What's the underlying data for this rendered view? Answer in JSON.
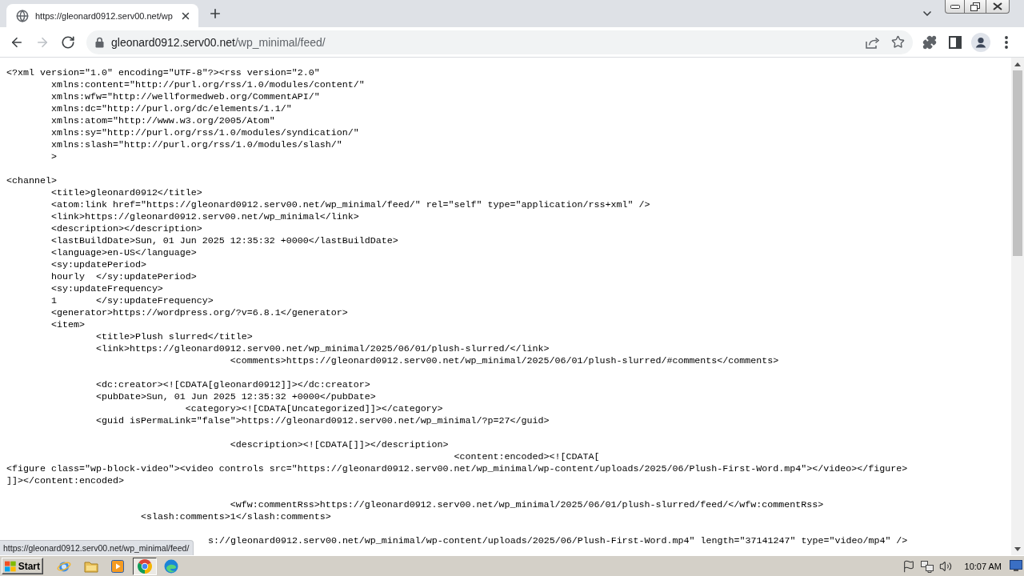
{
  "tabs": [
    {
      "title": "https://gleonard0912.serv00.net/wp",
      "selected": true
    }
  ],
  "toolbar": {
    "nav": [
      {
        "kind": "back",
        "disabled": false
      },
      {
        "kind": "forward",
        "disabled": true
      },
      {
        "kind": "reload",
        "disabled": false
      }
    ],
    "address": {
      "host": "gleonard0912.serv00.net",
      "path": "/wp_minimal/feed/"
    }
  },
  "document": {
    "blocks": [
      {
        "lines": [
          "<?xml version=\"1.0\" encoding=\"UTF-8\"?><rss version=\"2.0\"",
          "\txmlns:content=\"http://purl.org/rss/1.0/modules/content/\"",
          "\txmlns:wfw=\"http://wellformedweb.org/CommentAPI/\"",
          "\txmlns:dc=\"http://purl.org/dc/elements/1.1/\"",
          "\txmlns:atom=\"http://www.w3.org/2005/Atom\"",
          "\txmlns:sy=\"http://purl.org/rss/1.0/modules/syndication/\"",
          "\txmlns:slash=\"http://purl.org/rss/1.0/modules/slash/\"",
          "\t>"
        ]
      },
      {
        "lines": [
          "<channel>",
          "\t<title>gleonard0912</title>",
          "\t<atom:link href=\"https://gleonard0912.serv00.net/wp_minimal/feed/\" rel=\"self\" type=\"application/rss+xml\" />",
          "\t<link>https://gleonard0912.serv00.net/wp_minimal</link>",
          "\t<description></description>",
          "\t<lastBuildDate>Sun, 01 Jun 2025 12:35:32 +0000</lastBuildDate>",
          "\t<language>en-US</language>",
          "\t<sy:updatePeriod>",
          "\thourly\t</sy:updatePeriod>",
          "\t<sy:updateFrequency>",
          "\t1\t</sy:updateFrequency>",
          "\t<generator>https://wordpress.org/?v=6.8.1</generator>",
          "\t<item>",
          "\t\t<title>Plush slurred</title>",
          "\t\t<link>https://gleonard0912.serv00.net/wp_minimal/2025/06/01/plush-slurred/</link>",
          "\t\t\t\t\t<comments>https://gleonard0912.serv00.net/wp_minimal/2025/06/01/plush-slurred/#comments</comments>"
        ]
      },
      {
        "lines": [
          "\t\t<dc:creator><![CDATA[gleonard0912]]></dc:creator>",
          "\t\t<pubDate>Sun, 01 Jun 2025 12:35:32 +0000</pubDate>",
          "\t\t\t\t<category><![CDATA[Uncategorized]]></category>",
          "\t\t<guid isPermaLink=\"false\">https://gleonard0912.serv00.net/wp_minimal/?p=27</guid>"
        ]
      },
      {
        "lines": [
          "\t\t\t\t\t<description><![CDATA[]]></description>",
          "\t\t\t\t\t\t\t\t\t\t<content:encoded><![CDATA[",
          "<figure class=\"wp-block-video\"><video controls src=\"https://gleonard0912.serv00.net/wp_minimal/wp-content/uploads/2025/06/Plush-First-Word.mp4\"></video></figure>",
          "]]></content:encoded>"
        ]
      },
      {
        "lines": [
          "\t\t\t\t\t<wfw:commentRss>https://gleonard0912.serv00.net/wp_minimal/2025/06/01/plush-slurred/feed/</wfw:commentRss>",
          "\t\t\t<slash:comments>1</slash:comments>"
        ]
      }
    ],
    "covered_line": "s://gleonard0912.serv00.net/wp_minimal/wp-content/uploads/2025/06/Plush-First-Word.mp4\" length=\"37141247\" type=\"video/mp4\" />"
  },
  "status_bubble": {
    "url": "https://gleonard0912.serv00.net/wp_minimal/feed/"
  },
  "taskbar": {
    "start": "Start",
    "apps": [
      {
        "kind": "orbit",
        "selected": false
      },
      {
        "kind": "folder",
        "selected": false
      },
      {
        "kind": "player",
        "selected": false
      },
      {
        "kind": "round",
        "selected": true
      },
      {
        "kind": "wave",
        "selected": false
      }
    ],
    "clock": "10:07 AM"
  }
}
